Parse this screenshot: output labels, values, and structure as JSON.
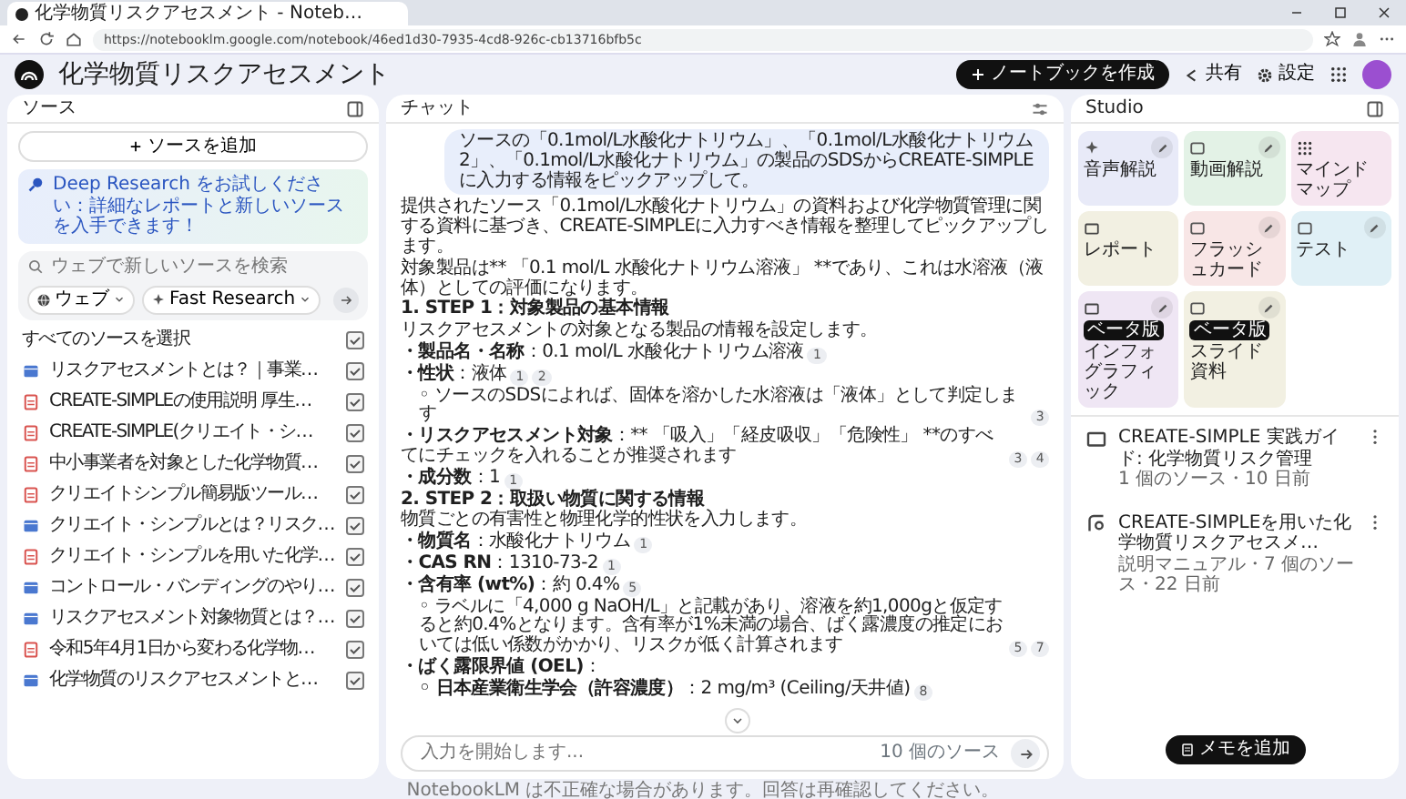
{
  "browser": {
    "tab_title": "化学物質リスクアセスメント - Noteb…",
    "url": "https://notebooklm.google.com/notebook/46ed1d30-7935-4cd8-926c-cb13716bfb5c"
  },
  "app": {
    "title": "化学物質リスクアセスメント",
    "create_button": "ノートブックを作成",
    "share_button": "共有",
    "settings_button": "設定"
  },
  "sources": {
    "title": "ソース",
    "add_button": "ソースを追加",
    "banner": "Deep Research をお試しください：詳細なレポートと新しいソースを入手できます！",
    "search": {
      "placeholder": "ウェブで新しいソースを検索",
      "chips": [
        "ウェブ",
        "Fast Research"
      ]
    },
    "select_all": {
      "label": "すべてのソースを選択",
      "checked": true
    },
    "items": [
      {
        "kind": "web",
        "title": "リスクアセスメントとは？｜事業…",
        "checked": true
      },
      {
        "kind": "pdf",
        "title": "CREATE-SIMPLEの使用説明 厚生…",
        "checked": true
      },
      {
        "kind": "pdf",
        "title": "CREATE-SIMPLE(クリエイト・シ…",
        "checked": true
      },
      {
        "kind": "pdf",
        "title": "中小事業者を対象とした化学物質…",
        "checked": true
      },
      {
        "kind": "pdf",
        "title": "クリエイトシンプル簡易版ツール…",
        "checked": true
      },
      {
        "kind": "web",
        "title": "クリエイト・シンプルとは？リスク…",
        "checked": true
      },
      {
        "kind": "pdf",
        "title": "クリエイト・シンプルを用いた化学…",
        "checked": true
      },
      {
        "kind": "web",
        "title": "コントロール・バンディングのやり…",
        "checked": true
      },
      {
        "kind": "web",
        "title": "リスクアセスメント対象物質とは？…",
        "checked": true
      },
      {
        "kind": "pdf",
        "title": "令和5年4月1日から変わる化学物…",
        "checked": true
      },
      {
        "kind": "web",
        "title": "化学物質のリスクアセスメントと…",
        "checked": true
      }
    ]
  },
  "chat": {
    "title": "チャット",
    "messages": [
      {
        "kind": "user",
        "text": "ソースの「0.1mol/L水酸化ナトリウム」、「0.1mol/L水酸化ナトリウム2」、「0.1mol/L水酸化ナトリウム」の製品のSDSからCREATE-SIMPLEに入力する情報をピックアップして。"
      },
      {
        "kind": "para",
        "text": "提供されたソース「0.1mol/L水酸化ナトリウム」の資料および化学物質管理に関する資料に基づき、CREATE-SIMPLEに入力すべき情報を整理してピックアップします。"
      },
      {
        "kind": "para",
        "text": "対象製品は** 「0.1 mol/L 水酸化ナトリウム溶液」 **であり、これは水溶液（液体）としての評価になります。"
      },
      {
        "kind": "heading",
        "text": "1. STEP 1：対象製品の基本情報"
      },
      {
        "kind": "para",
        "text": "リスクアセスメントの対象となる製品の情報を設定します。"
      },
      {
        "kind": "field",
        "label": "・製品名・名称",
        "text": "：0.1 mol/L 水酸化ナトリウム溶液",
        "cites": [
          "1"
        ]
      },
      {
        "kind": "field",
        "label": "・性状",
        "text": "：液体",
        "cites": [
          "1",
          "2"
        ]
      },
      {
        "kind": "sub",
        "text": "◦ ソースのSDSによれば、固体を溶かした水溶液は「液体」として判定します",
        "cites": [
          "3"
        ]
      },
      {
        "kind": "field",
        "label": "・リスクアセスメント対象",
        "text": "：** 「吸入」「経皮吸収」「危険性」 **のすべてにチェックを入れることが推奨されます",
        "cites": [
          "3",
          "4"
        ]
      },
      {
        "kind": "field",
        "label": "・成分数",
        "text": "：1",
        "cites": [
          "1"
        ]
      },
      {
        "kind": "heading",
        "text": "2. STEP 2：取扱い物質に関する情報"
      },
      {
        "kind": "para",
        "text": "物質ごとの有害性と物理化学的性状を入力します。"
      },
      {
        "kind": "field",
        "label": "・物質名",
        "text": "：水酸化ナトリウム",
        "cites": [
          "1"
        ]
      },
      {
        "kind": "field",
        "label": "・CAS RN",
        "text": "：1310-73-2",
        "cites": [
          "1"
        ]
      },
      {
        "kind": "field",
        "label": "・含有率 (wt%)",
        "text": "：約 0.4%",
        "cites": [
          "5"
        ]
      },
      {
        "kind": "sub",
        "text": "◦ ラベルに「4,000 g NaOH/L」と記載があり、溶液を約1,000gと仮定すると約0.4%となります。含有率が1%未満の場合、ばく露濃度の推定においては低い係数がかかり、リスクが低く計算されます",
        "cites": [
          "5",
          "7"
        ]
      },
      {
        "kind": "field",
        "label": "・ばく露限界値 (OEL)",
        "text": "："
      },
      {
        "kind": "sub",
        "label": "◦ 日本産業衛生学会（許容濃度）",
        "text": "：2 mg/m³ (Ceiling/天井値)",
        "cites": [
          "8"
        ]
      }
    ],
    "input": {
      "placeholder": "入力を開始します...",
      "source_count": "10 個のソース"
    }
  },
  "studio": {
    "title": "Studio",
    "tiles": [
      {
        "label": "音声解説",
        "color": "#e8eaf8",
        "pencil": true
      },
      {
        "label": "動画解説",
        "color": "#e3f2e6",
        "pencil": true
      },
      {
        "label": "マインドマップ",
        "color": "#f6e6f0",
        "pencil": false
      },
      {
        "label": "レポート",
        "color": "#f2f0e2",
        "pencil": false
      },
      {
        "label": "フラッシュカード",
        "color": "#f8e6e6",
        "pencil": true
      },
      {
        "label": "テスト",
        "color": "#e0f0f6",
        "pencil": true
      },
      {
        "label": "インフォグラフィック",
        "color": "#efe6f4",
        "pencil": true,
        "badge": "ベータ版"
      },
      {
        "label": "スライド資料",
        "color": "#f2f0e2",
        "pencil": true,
        "badge": "ベータ版"
      }
    ],
    "notes": [
      {
        "kind": "doc",
        "title": "CREATE-SIMPLE 実践ガイド: 化学物質リスク管理",
        "meta": "1 個のソース・10 日前"
      },
      {
        "kind": "guide",
        "title": "CREATE-SIMPLEを用いた化学物質リスクアセスメ…",
        "meta": "説明マニュアル・7 個のソース・22 日前"
      }
    ],
    "add_note": "メモを追加"
  },
  "footer": "NotebookLM は不正確な場合があります。回答は再確認してください。"
}
